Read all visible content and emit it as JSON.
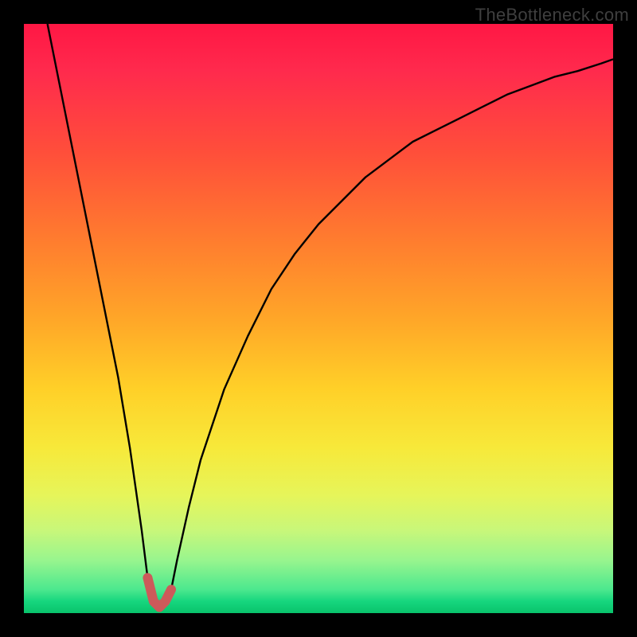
{
  "watermark": "TheBottleneck.com",
  "chart_data": {
    "type": "line",
    "title": "",
    "xlabel": "",
    "ylabel": "",
    "xlim": [
      0,
      100
    ],
    "ylim": [
      0,
      100
    ],
    "series": [
      {
        "name": "bottleneck-curve",
        "x": [
          4,
          6,
          8,
          10,
          12,
          14,
          16,
          18,
          20,
          21,
          22,
          23,
          24,
          25,
          26,
          28,
          30,
          34,
          38,
          42,
          46,
          50,
          54,
          58,
          62,
          66,
          70,
          74,
          78,
          82,
          86,
          90,
          94,
          98,
          100
        ],
        "values": [
          100,
          90,
          80,
          70,
          60,
          50,
          40,
          28,
          14,
          6,
          2,
          1,
          2,
          4,
          9,
          18,
          26,
          38,
          47,
          55,
          61,
          66,
          70,
          74,
          77,
          80,
          82,
          84,
          86,
          88,
          89.5,
          91,
          92,
          93.3,
          94
        ]
      }
    ],
    "marker": {
      "name": "operating-point",
      "x": 23,
      "y": 1,
      "points": [
        {
          "x": 21,
          "y": 6
        },
        {
          "x": 22,
          "y": 2
        },
        {
          "x": 23,
          "y": 1
        },
        {
          "x": 24,
          "y": 2
        },
        {
          "x": 25,
          "y": 4
        }
      ],
      "color": "#cc5a5a"
    },
    "gradient_stops": [
      {
        "pos": 0.0,
        "color": "#ff1744"
      },
      {
        "pos": 0.5,
        "color": "#ffa628"
      },
      {
        "pos": 0.8,
        "color": "#e6f55a"
      },
      {
        "pos": 1.0,
        "color": "#09c36b"
      }
    ]
  }
}
